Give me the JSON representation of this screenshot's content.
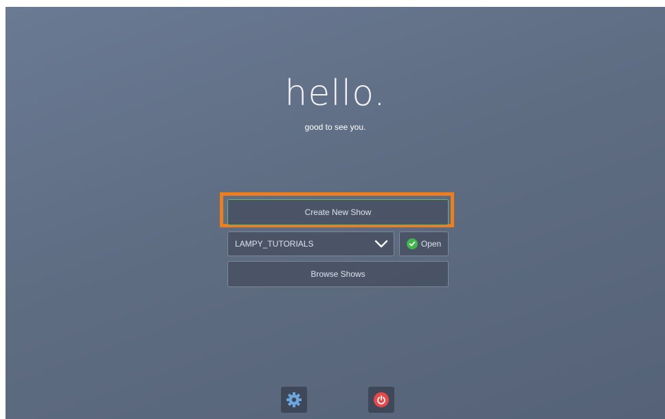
{
  "welcome": {
    "title": "hello.",
    "subtitle": "good to see you."
  },
  "actions": {
    "create_label": "Create New Show",
    "show_select_value": "LAMPY_TUTORIALS",
    "open_label": "Open",
    "browse_label": "Browse Shows"
  },
  "footer": {
    "settings_icon": "gear-icon",
    "power_icon": "power-icon"
  },
  "colors": {
    "highlight": "#f07d1b",
    "create_border": "#63b86a",
    "open_check": "#42b54a",
    "power": "#e84848",
    "gear": "#6aa7de"
  }
}
